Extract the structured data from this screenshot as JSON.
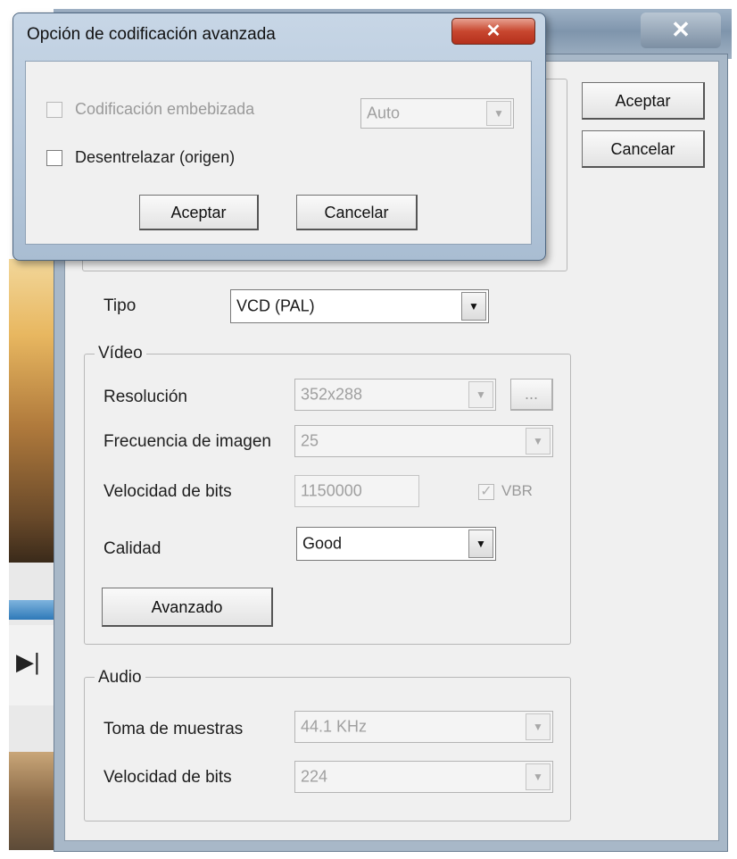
{
  "main_window": {
    "buttons": {
      "ok": "Aceptar",
      "cancel": "Cancelar"
    },
    "type_label": "Tipo",
    "type_value": "VCD (PAL)",
    "video": {
      "caption": "Vídeo",
      "resolution_label": "Resolución",
      "resolution_value": "352x288",
      "resolution_button": "...",
      "framerate_label": "Frecuencia de imagen",
      "framerate_value": "25",
      "bitrate_label": "Velocidad de bits",
      "bitrate_value": "1150000",
      "vbr_label": "VBR",
      "quality_label": "Calidad",
      "quality_value": "Good",
      "advanced_button": "Avanzado"
    },
    "audio": {
      "caption": "Audio",
      "samplerate_label": "Toma de muestras",
      "samplerate_value": "44.1 KHz",
      "bitrate_label": "Velocidad de bits",
      "bitrate_value": "224"
    },
    "close_glyph": "✕"
  },
  "dialog": {
    "title": "Opción de codificación avanzada",
    "close_glyph": "✕",
    "embedded_label": "Codificación embebizada",
    "embedded_value": "Auto",
    "deinterlace_label": "Desentrelazar (origen)",
    "ok": "Aceptar",
    "cancel": "Cancelar"
  },
  "background": {
    "playback_glyph": "▶|"
  },
  "icons": [
    "close-icon",
    "dropdown-arrow-icon",
    "checkbox-icon",
    "next-track-icon"
  ]
}
